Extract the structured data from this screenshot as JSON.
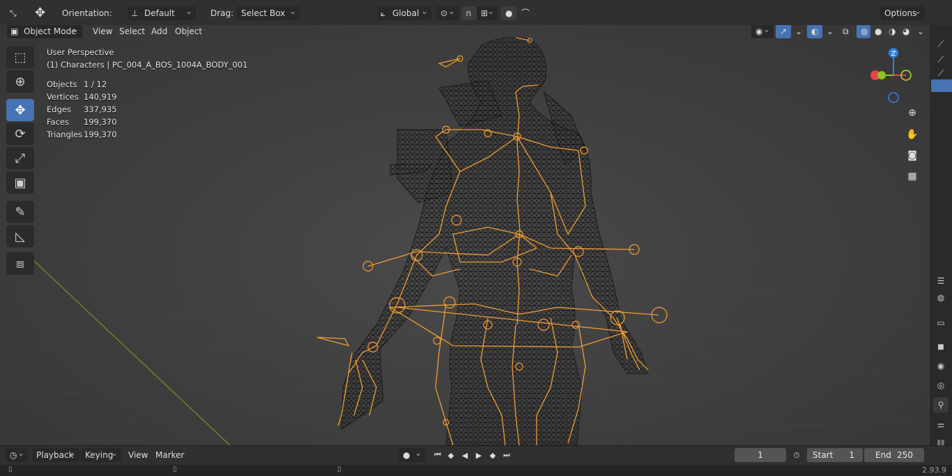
{
  "topbar": {
    "orientation_label": "Orientation:",
    "orientation_value": "Default",
    "drag_label": "Drag:",
    "drag_value": "Select Box",
    "transform_space": "Global",
    "options_label": "Options"
  },
  "header": {
    "mode": "Object Mode",
    "menus": [
      "View",
      "Select",
      "Add",
      "Object"
    ]
  },
  "overlay": {
    "view_name": "User Perspective",
    "collection_object": "(1) Characters | PC_004_A_BOS_1004A_BODY_001",
    "stats": [
      {
        "label": "Objects",
        "value": "1 / 12"
      },
      {
        "label": "Vertices",
        "value": "140,919"
      },
      {
        "label": "Edges",
        "value": "337,935"
      },
      {
        "label": "Faces",
        "value": "199,370"
      },
      {
        "label": "Triangles",
        "value": "199,370"
      }
    ]
  },
  "gizmo": {
    "z_label": "Z",
    "x_color": "#e2484f",
    "y_color": "#8ac427",
    "z_color": "#2f83e3"
  },
  "timeline": {
    "menus": [
      "Playback",
      "Keying",
      "View",
      "Marker"
    ],
    "current_frame": "1",
    "start_label": "Start",
    "start_value": "1",
    "end_label": "End",
    "end_value": "250"
  },
  "status": {
    "version": "2.93.9"
  },
  "colors": {
    "accent": "#4772b3",
    "bone": "#f5a13a",
    "wire": "#0d0d0d"
  },
  "icons": {
    "tools": [
      "select-box-icon",
      "cursor-icon",
      "move-icon",
      "rotate-icon",
      "scale-icon",
      "transform-icon",
      "annotate-icon",
      "measure-icon",
      "add-cube-icon"
    ],
    "nav": [
      "zoom-icon",
      "hand-pan-icon",
      "camera-icon",
      "grid-perspective-icon"
    ]
  }
}
